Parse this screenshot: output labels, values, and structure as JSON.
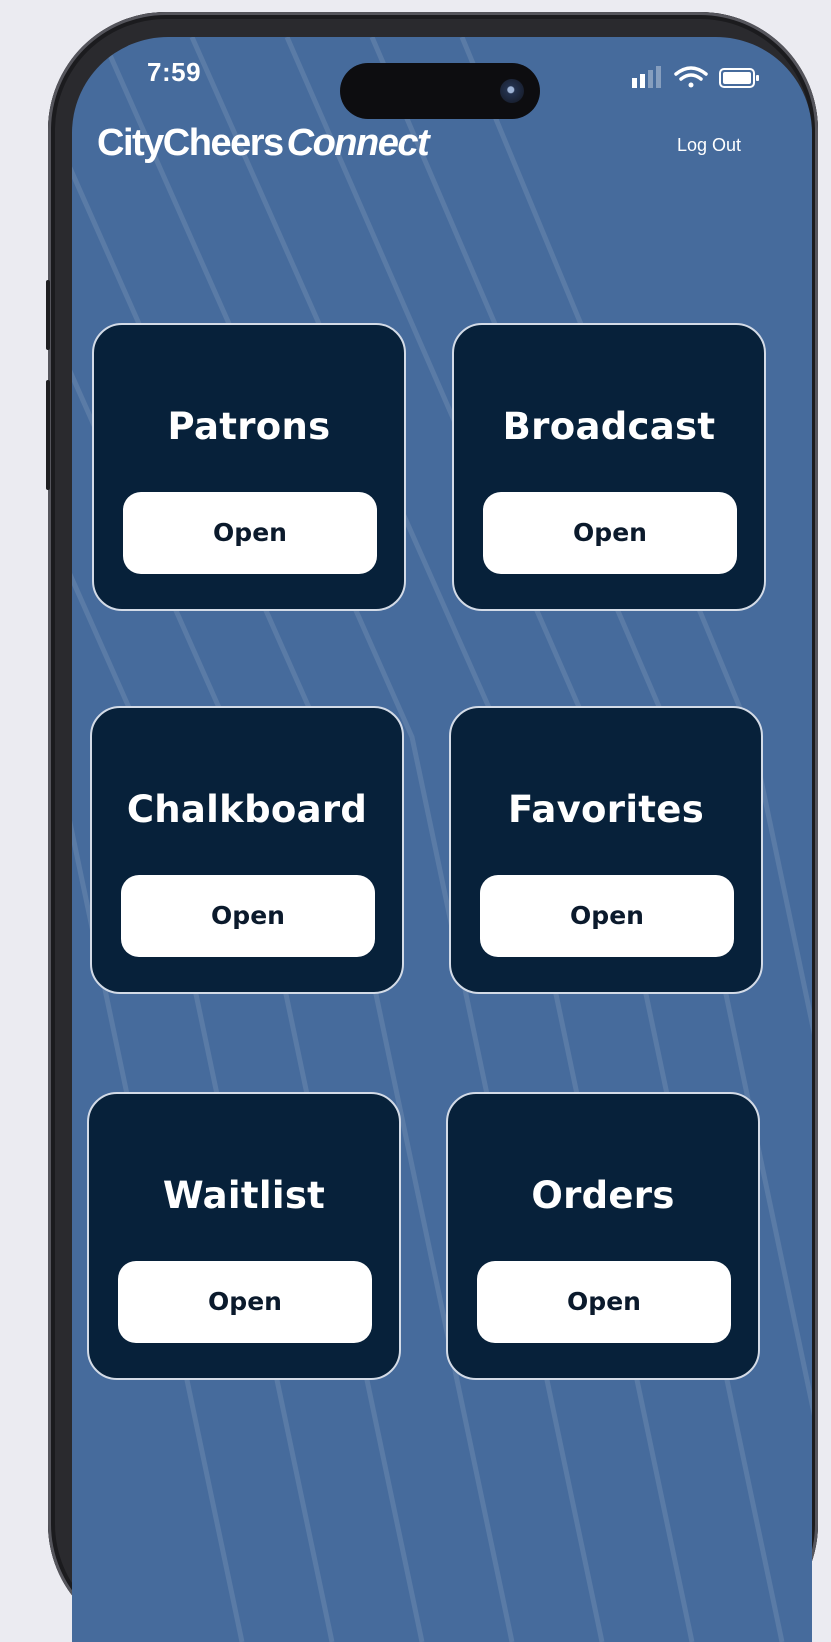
{
  "status_bar": {
    "time": "7:59",
    "signal_icon": "cellular-signal-icon",
    "wifi_icon": "wifi-icon",
    "battery_icon": "battery-icon"
  },
  "header": {
    "brand_part1": "CityCheers",
    "brand_part2": "Connect",
    "logout_label": "Log Out"
  },
  "tiles": [
    {
      "title": "Patrons",
      "button_label": "Open"
    },
    {
      "title": "Broadcast",
      "button_label": "Open"
    },
    {
      "title": "Chalkboard",
      "button_label": "Open"
    },
    {
      "title": "Favorites",
      "button_label": "Open"
    },
    {
      "title": "Waitlist",
      "button_label": "Open"
    },
    {
      "title": "Orders",
      "button_label": "Open"
    }
  ],
  "colors": {
    "background": "#466b9c",
    "card": "#07213a",
    "button": "#ffffff",
    "text_on_card": "#ffffff",
    "button_text": "#0b1a2c"
  }
}
